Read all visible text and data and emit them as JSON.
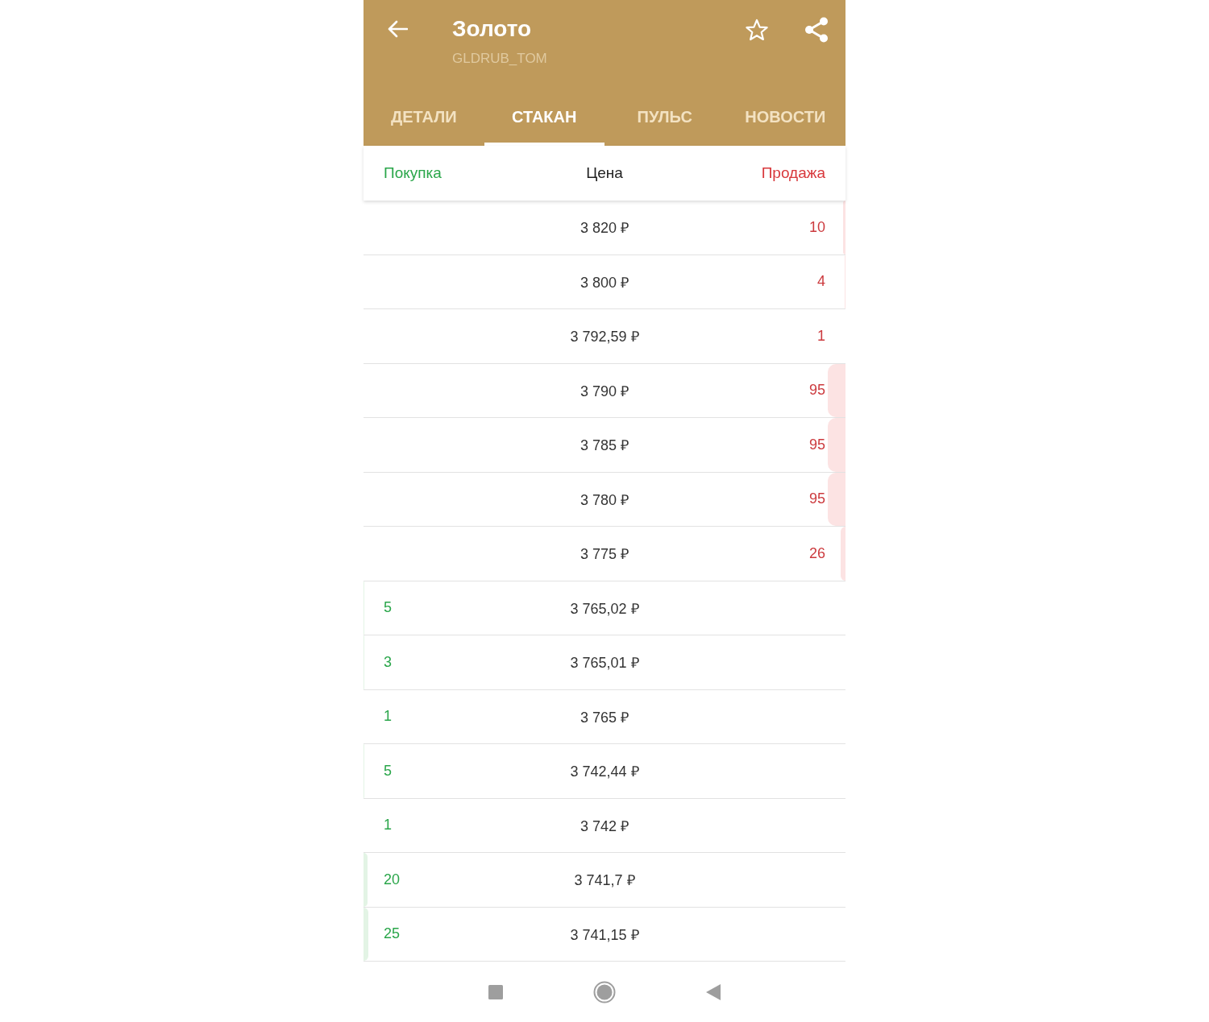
{
  "app_bar": {
    "title": "Золото",
    "subtitle": "GLDRUB_TOM"
  },
  "tabs": [
    {
      "label": "ДЕТАЛИ",
      "selected": false
    },
    {
      "label": "СТАКАН",
      "selected": true
    },
    {
      "label": "ПУЛЬС",
      "selected": false
    },
    {
      "label": "НОВОСТИ",
      "selected": false
    }
  ],
  "order_book": {
    "columns": [
      {
        "label": "Покупка",
        "kind": "buy"
      },
      {
        "label": "Цена",
        "kind": "price"
      },
      {
        "label": "Продажа",
        "kind": "sell"
      }
    ],
    "rows": [
      {
        "kind": "sell",
        "price": "3 820 ₽",
        "quantity": "10",
        "level": 0.005
      },
      {
        "kind": "sell",
        "price": "3 800 ₽",
        "quantity": "4",
        "level": 0.002
      },
      {
        "kind": "sell",
        "price": "3 792,59 ₽",
        "quantity": "1"
      },
      {
        "kind": "sell",
        "price": "3 790 ₽",
        "quantity": "95",
        "level": 0.037
      },
      {
        "kind": "sell",
        "price": "3 785 ₽",
        "quantity": "95",
        "level": 0.037
      },
      {
        "kind": "sell",
        "price": "3 780 ₽",
        "quantity": "95",
        "level": 0.037
      },
      {
        "kind": "sell",
        "price": "3 775 ₽",
        "quantity": "26",
        "level": 0.01
      },
      {
        "kind": "buy",
        "price": "3 765,02 ₽",
        "quantity": "5",
        "level": 0.002
      },
      {
        "kind": "buy",
        "price": "3 765,01 ₽",
        "quantity": "3",
        "level": 0.002
      },
      {
        "kind": "buy",
        "price": "3 765 ₽",
        "quantity": "1"
      },
      {
        "kind": "buy",
        "price": "3 742,44 ₽",
        "quantity": "5",
        "level": 0.002
      },
      {
        "kind": "buy",
        "price": "3 742 ₽",
        "quantity": "1"
      },
      {
        "kind": "buy",
        "price": "3 741,7 ₽",
        "quantity": "20",
        "level": 0.008
      },
      {
        "kind": "buy",
        "price": "3 741,15 ₽",
        "quantity": "25",
        "level": 0.01
      }
    ]
  }
}
